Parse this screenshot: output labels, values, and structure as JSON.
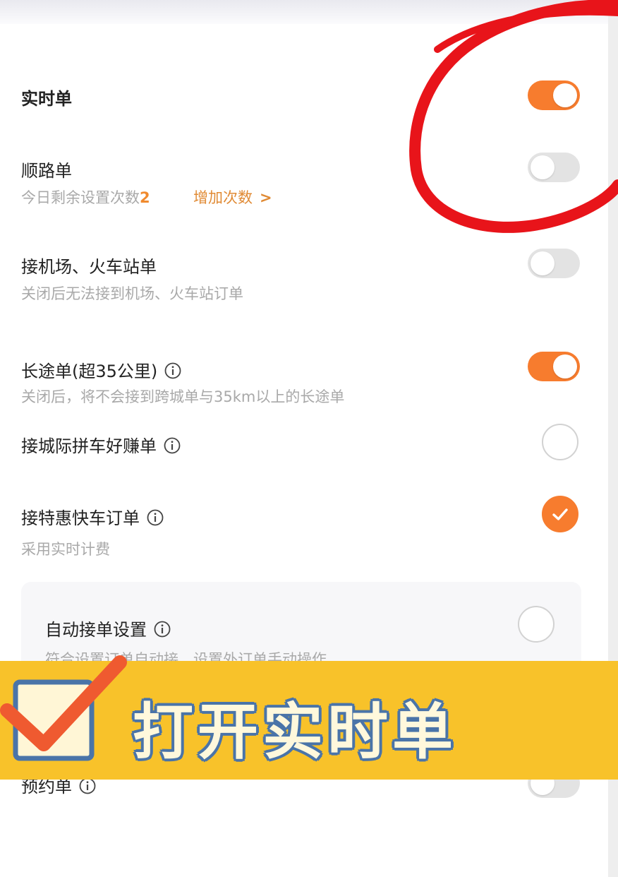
{
  "rows": {
    "realtime": {
      "title": "实时单",
      "toggle": "on"
    },
    "shunlu": {
      "title": "顺路单",
      "sub_prefix": "今日剩余设置次数",
      "sub_count": "2",
      "add_link": "增加次数",
      "toggle": "off"
    },
    "airport": {
      "title": "接机场、火车站单",
      "sub": "关闭后无法接到机场、火车站订单",
      "toggle": "off"
    },
    "longtrip": {
      "title": "长途单(超35公里)",
      "sub": "关闭后，将不会接到跨城单与35km以上的长途单",
      "toggle": "on"
    },
    "intercity": {
      "title": "接城际拼车好赚单",
      "selected": false
    },
    "discount": {
      "title": "接特惠快车订单",
      "sub": "采用实时计费",
      "selected": true
    },
    "auto": {
      "title": "自动接单设置",
      "sub": "符合设置订单自动接，设置外订单手动操作",
      "selected": false
    },
    "reserve": {
      "title": "预约单",
      "toggle": "off"
    }
  },
  "banner": {
    "text": "打开实时单",
    "background": "#f8c22a"
  },
  "colors": {
    "accent": "#f77c2e",
    "link": "#e08a34",
    "annotation": "#e8141a"
  },
  "icons": [
    "info-icon",
    "chevron-right-icon",
    "check-icon",
    "checkbox-icon"
  ]
}
